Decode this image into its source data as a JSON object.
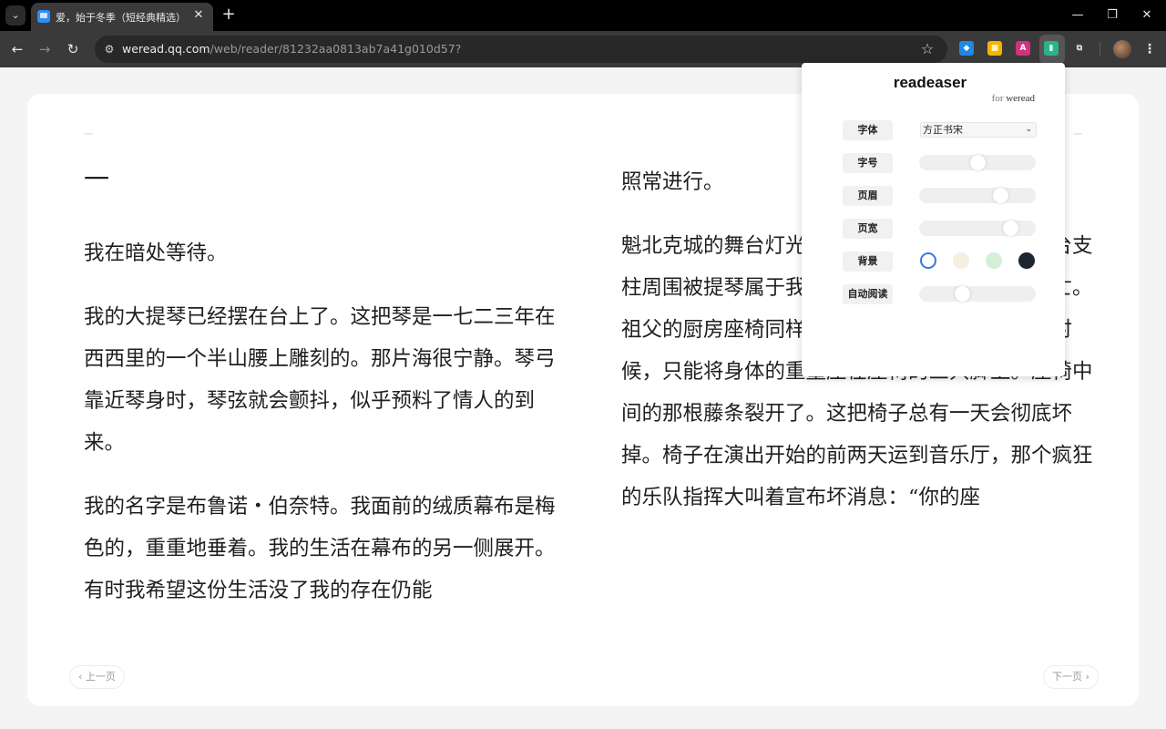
{
  "browser": {
    "tab": {
      "title": "爱，始于冬季（短经典精选）",
      "close_glyph": "✕"
    },
    "new_tab_glyph": "+",
    "window": {
      "minimize": "—",
      "maximize": "❐",
      "close": "✕"
    },
    "nav": {
      "back": "←",
      "forward": "→",
      "reload": "↻"
    },
    "url": {
      "host": "weread.qq.com",
      "path": "/web/reader/81232aa0813ab7a41g010d57?"
    },
    "extensions": [
      {
        "name": "diamond-extension-icon",
        "glyph": "◆",
        "bg": "#1e88e5",
        "fg": "#ffffff"
      },
      {
        "name": "yellow-extension-icon",
        "glyph": "■",
        "bg": "#f5b400",
        "fg": "#fff3b0"
      },
      {
        "name": "translate-extension-icon",
        "glyph": "A",
        "bg": "#d2327a",
        "fg": "#ffffff"
      },
      {
        "name": "readeaser-extension-icon",
        "glyph": "▮",
        "bg": "#2ab38a",
        "fg": "#d8fff0"
      },
      {
        "name": "puzzle-extensions-icon",
        "glyph": "⧉",
        "bg": "transparent",
        "fg": "#e0e0e0"
      }
    ]
  },
  "reader": {
    "page_marks": {
      "left": "一",
      "right": "一"
    },
    "left_column": {
      "chapter": "一",
      "paragraphs": [
        "我在暗处等待。",
        "我的大提琴已经摆在台上了。这把琴是一七二三年在西西里的一个半山腰上雕刻的。那片海很宁静。琴弓靠近琴身时，琴弦就会颤抖，似乎预料了情人的到来。",
        "我的名字是布鲁诺・伯奈特。我面前的绒质幕布是梅色的，重重地垂着。我的生活在幕布的另一侧展开。有时我希望这份生活没了我的存在仍能"
      ]
    },
    "right_column": {
      "paragraphs": [
        "照常进行。",
        "魁北克城的舞台灯光加拿大口音的法语介绍及舞台支柱周围被提琴属于我的祖父，他在二战中患病身亡。祖父的厨房座椅同样也在舞台上。我坐在上面的时候，只能将身体的重量压在座椅的三只脚上。座椅中间的那根藤条裂开了。这把椅子总有一天会彻底坏掉。椅子在演出开始的前两天运到音乐厅，那个疯狂的乐队指挥大叫着宣布坏消息：“你的座"
      ]
    },
    "prev_page": "上一页",
    "next_page": "下一页"
  },
  "popup": {
    "title": "readeaser",
    "subtitle_prefix": "for",
    "subtitle": "weread",
    "labels": {
      "font": "字体",
      "size": "字号",
      "margin": "页眉",
      "width": "页宽",
      "background": "背景",
      "autoread": "自动阅读"
    },
    "font_value": "方正书宋",
    "sliders": {
      "size": 0.5,
      "margin": 0.72,
      "width": 0.82,
      "autoread": 0.35
    },
    "backgrounds": [
      {
        "name": "white",
        "color": "#ffffff",
        "selected": true
      },
      {
        "name": "cream",
        "color": "#f5efdf",
        "selected": false
      },
      {
        "name": "green",
        "color": "#d5efd6",
        "selected": false
      },
      {
        "name": "dark",
        "color": "#1e2533",
        "selected": false
      }
    ]
  }
}
